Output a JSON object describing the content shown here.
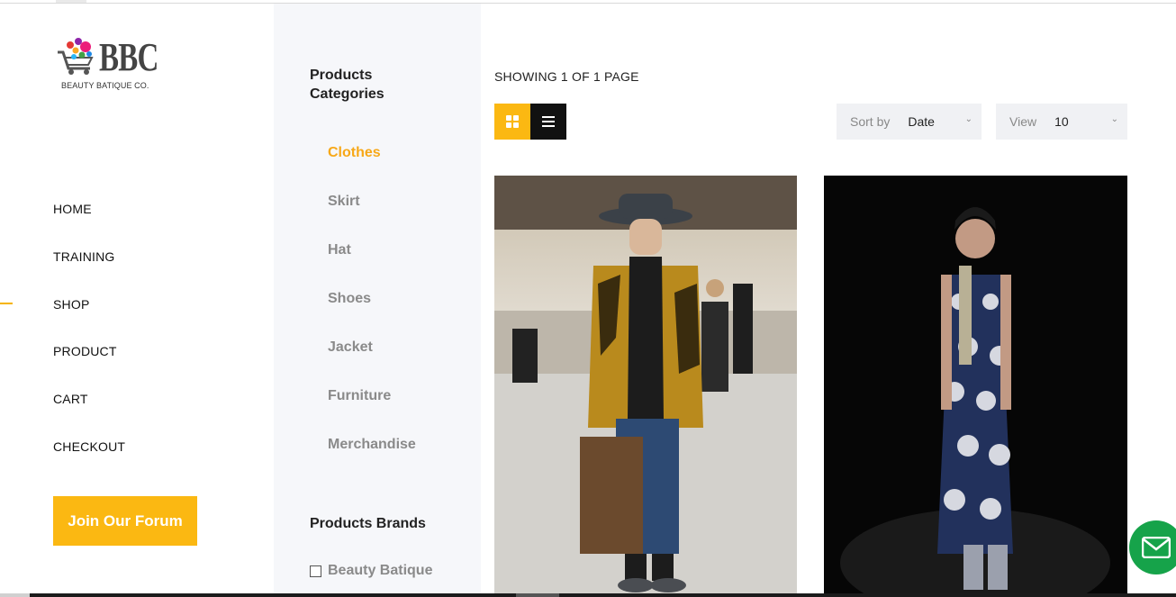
{
  "brand": {
    "name": "BBC",
    "tagline": "BEAUTY BATIQUE CO."
  },
  "nav": {
    "items": [
      {
        "label": "HOME"
      },
      {
        "label": "TRAINING"
      },
      {
        "label": "SHOP"
      },
      {
        "label": "PRODUCT"
      },
      {
        "label": "CART"
      },
      {
        "label": "CHECKOUT"
      }
    ],
    "active": "SHOP",
    "forum_button": "Join Our Forum"
  },
  "categories": {
    "title": "Products Categories",
    "items": [
      {
        "label": "Clothes"
      },
      {
        "label": "Skirt"
      },
      {
        "label": "Hat"
      },
      {
        "label": "Shoes"
      },
      {
        "label": "Jacket"
      },
      {
        "label": "Furniture"
      },
      {
        "label": "Merchandise"
      }
    ],
    "active": "Clothes"
  },
  "brands": {
    "title": "Products Brands",
    "items": [
      {
        "label": "Beauty Batique",
        "checked": false
      }
    ]
  },
  "toolbar": {
    "showing_text": "SHOWING 1 OF 1 PAGE",
    "sort_label": "Sort by",
    "sort_value": "Date",
    "view_label": "View",
    "view_value": "10",
    "layout": "grid"
  },
  "colors": {
    "accent": "#fbb812",
    "active_category": "#f7a818",
    "chat": "#16a34a",
    "panel_bg": "#f6f7fa"
  },
  "icons": {
    "grid": "grid-view-icon",
    "list": "list-view-icon",
    "chevron": "chevron-down-icon",
    "chat": "mail-icon"
  }
}
